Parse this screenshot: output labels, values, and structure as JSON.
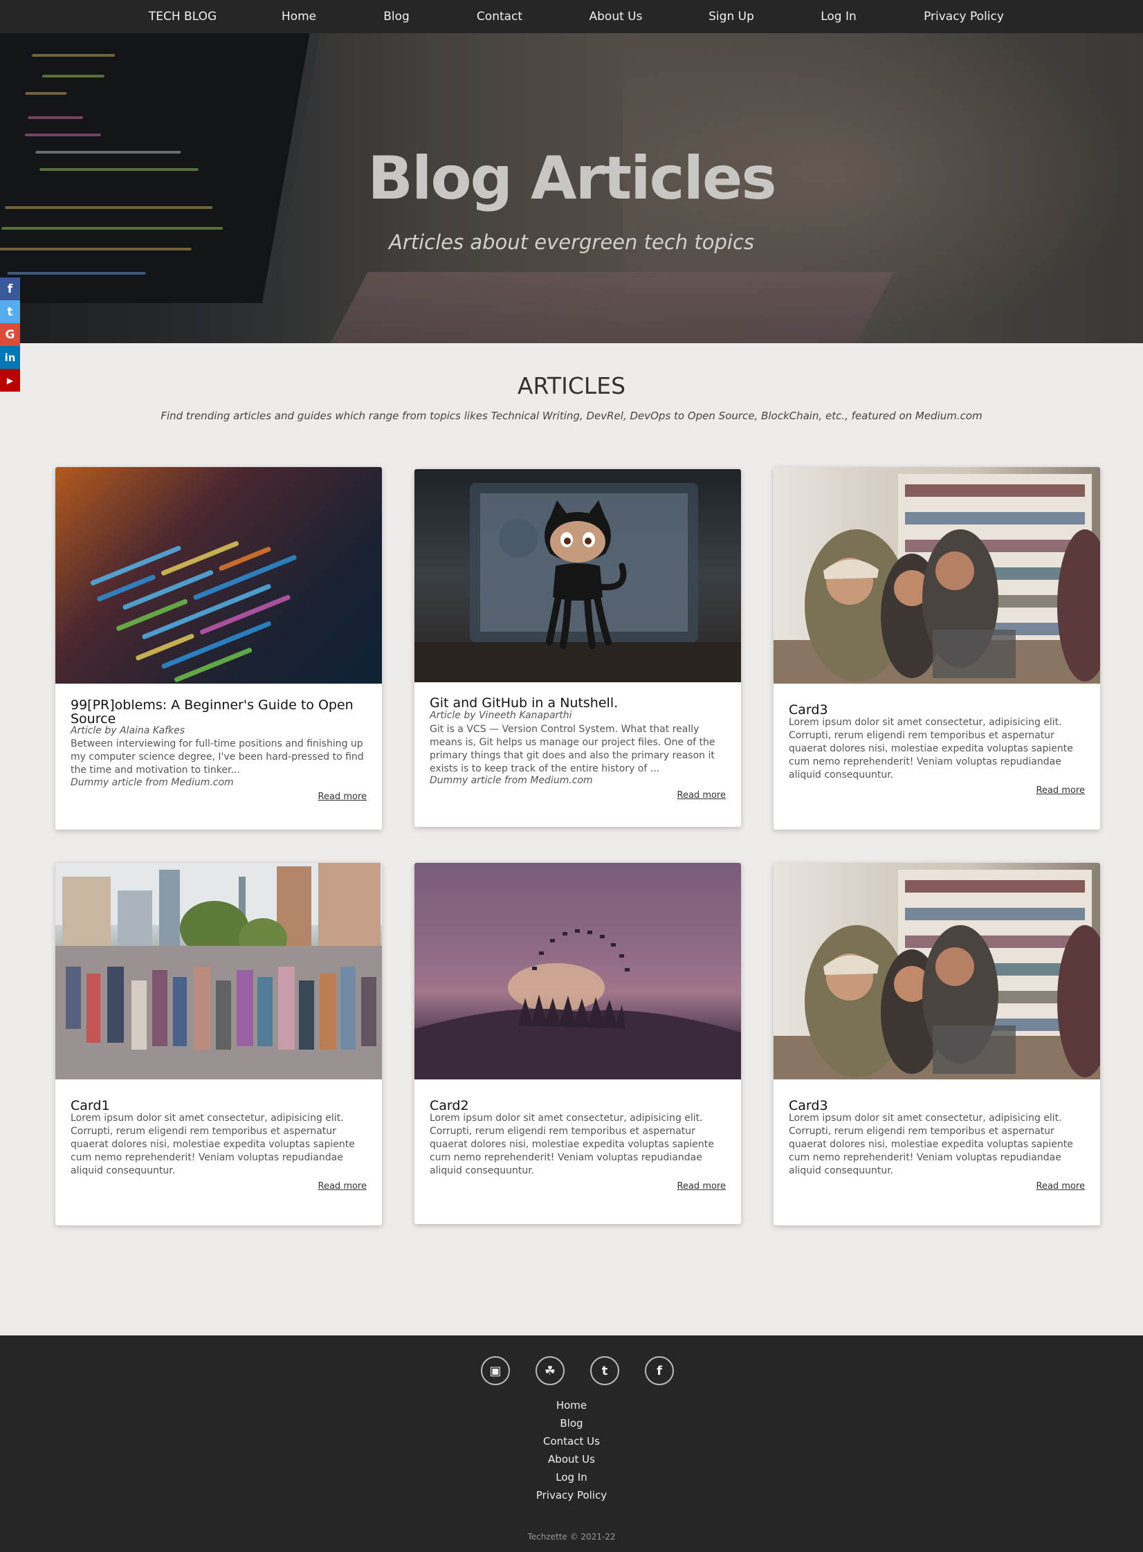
{
  "nav": {
    "brand": "TECH BLOG",
    "items": [
      "Home",
      "Blog",
      "Contact",
      "About Us",
      "Sign Up",
      "Log In",
      "Privacy Policy"
    ]
  },
  "hero": {
    "title": "Blog Articles",
    "subtitle": "Articles about evergreen tech topics"
  },
  "social": [
    "facebook-icon",
    "twitter-icon",
    "google-icon",
    "linkedin-icon",
    "youtube-icon"
  ],
  "social_glyphs": [
    "f",
    "t",
    "G",
    "in",
    "▶"
  ],
  "social_colors": [
    "#3b5998",
    "#55acee",
    "#dd4b39",
    "#0077b5",
    "#bb0000"
  ],
  "articles": {
    "heading": "ARTICLES",
    "description": "Find trending articles and guides which range from topics likes Technical Writing, DevRel, DevOps to Open Source, BlockChain, etc., featured on Medium.com"
  },
  "cards": [
    {
      "title": "99[PR]oblems: A Beginner's Guide to Open Source",
      "author": "Article by Alaina Kafkes",
      "body": "Between interviewing for full-time positions and finishing up my computer science degree, I've been hard-pressed to find the time and motivation to tinker...",
      "source": "Dummy article from Medium.com",
      "more": "Read more"
    },
    {
      "title": "Git and GitHub in a Nutshell.",
      "author": "Article by Vineeth Kanaparthi",
      "body": "Git is a VCS — Version Control System. What that really means is, Git helps us manage our project files. One of the primary things that git does and also the primary reason it exists is to keep track of the entire history of ...",
      "source": "Dummy article from Medium.com",
      "more": "Read more"
    },
    {
      "title": "Card3",
      "body": "Lorem ipsum dolor sit amet consectetur, adipisicing elit. Corrupti, rerum eligendi rem temporibus et aspernatur quaerat dolores nisi, molestiae expedita voluptas sapiente cum nemo reprehenderit! Veniam voluptas repudiandae aliquid consequuntur.",
      "more": "Read more"
    },
    {
      "title": "Card1",
      "body": "Lorem ipsum dolor sit amet consectetur, adipisicing elit. Corrupti, rerum eligendi rem temporibus et aspernatur quaerat dolores nisi, molestiae expedita voluptas sapiente cum nemo reprehenderit! Veniam voluptas repudiandae aliquid consequuntur.",
      "more": "Read more"
    },
    {
      "title": "Card2",
      "body": "Lorem ipsum dolor sit amet consectetur, adipisicing elit. Corrupti, rerum eligendi rem temporibus et aspernatur quaerat dolores nisi, molestiae expedita voluptas sapiente cum nemo reprehenderit! Veniam voluptas repudiandae aliquid consequuntur.",
      "more": "Read more"
    },
    {
      "title": "Card3",
      "body": "Lorem ipsum dolor sit amet consectetur, adipisicing elit. Corrupti, rerum eligendi rem temporibus et aspernatur quaerat dolores nisi, molestiae expedita voluptas sapiente cum nemo reprehenderit! Veniam voluptas repudiandae aliquid consequuntur.",
      "more": "Read more"
    }
  ],
  "footer": {
    "icons": [
      "instagram-icon",
      "snapchat-icon",
      "twitter-icon",
      "facebook-icon"
    ],
    "icon_glyphs": [
      "▣",
      "☘",
      "t",
      "f"
    ],
    "links": [
      "Home",
      "Blog",
      "Contact Us",
      "About Us",
      "Log In",
      "Privacy Policy"
    ],
    "copyright": "Techzette © 2021-22"
  }
}
